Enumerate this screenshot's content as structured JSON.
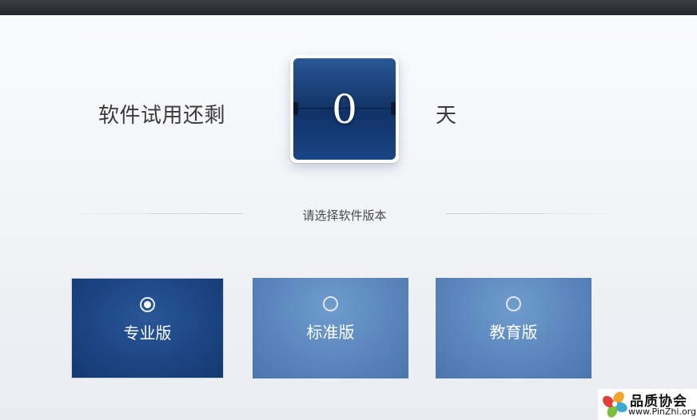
{
  "trial": {
    "label": "软件试用还剩",
    "days_remaining": "0",
    "unit": "天"
  },
  "edition_prompt": "请选择软件版本",
  "editions": [
    {
      "label": "专业版",
      "selected": true
    },
    {
      "label": "标准版",
      "selected": false
    },
    {
      "label": "教育版",
      "selected": false
    }
  ],
  "watermark": {
    "title": "品质协会",
    "url": "www.PinZhi.org"
  },
  "colors": {
    "titlebar": "#2c2f33",
    "selected_edition": "#1c4583",
    "unselected_edition": "#5a86bc",
    "flip_card": "#143a72"
  }
}
